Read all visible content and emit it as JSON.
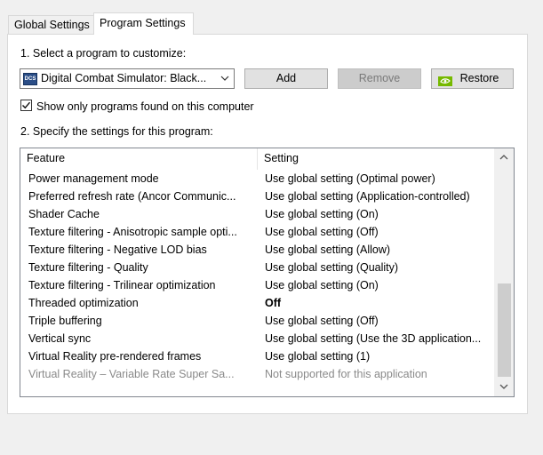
{
  "tabs": [
    {
      "label": "Global Settings",
      "active": false
    },
    {
      "label": "Program Settings",
      "active": true
    }
  ],
  "step1_label": "1. Select a program to customize:",
  "program_select": {
    "value": "Digital Combat Simulator: Black...",
    "icon": "dcs-app-icon"
  },
  "buttons": {
    "add": "Add",
    "remove": "Remove",
    "restore": "Restore"
  },
  "show_only_checkbox": {
    "label": "Show only programs found on this computer",
    "checked": true
  },
  "step2_label": "2. Specify the settings for this program:",
  "table": {
    "headers": {
      "feature": "Feature",
      "setting": "Setting"
    },
    "rows": [
      {
        "feature": "Power management mode",
        "setting": "Use global setting (Optimal power)"
      },
      {
        "feature": "Preferred refresh rate (Ancor Communic...",
        "setting": "Use global setting (Application-controlled)"
      },
      {
        "feature": "Shader Cache",
        "setting": "Use global setting (On)"
      },
      {
        "feature": "Texture filtering - Anisotropic sample opti...",
        "setting": "Use global setting (Off)"
      },
      {
        "feature": "Texture filtering - Negative LOD bias",
        "setting": "Use global setting (Allow)"
      },
      {
        "feature": "Texture filtering - Quality",
        "setting": "Use global setting (Quality)"
      },
      {
        "feature": "Texture filtering - Trilinear optimization",
        "setting": "Use global setting (On)"
      },
      {
        "feature": "Threaded optimization",
        "setting": "Off",
        "bold": true
      },
      {
        "feature": "Triple buffering",
        "setting": "Use global setting (Off)"
      },
      {
        "feature": "Vertical sync",
        "setting": "Use global setting (Use the 3D application..."
      },
      {
        "feature": "Virtual Reality pre-rendered frames",
        "setting": "Use global setting (1)"
      },
      {
        "feature": "Virtual Reality – Variable Rate Super Sa...",
        "setting": "Not supported for this application",
        "disabled": true
      }
    ]
  },
  "colors": {
    "nvidia_green": "#76b900",
    "dim_text": "#8a8a8a"
  }
}
